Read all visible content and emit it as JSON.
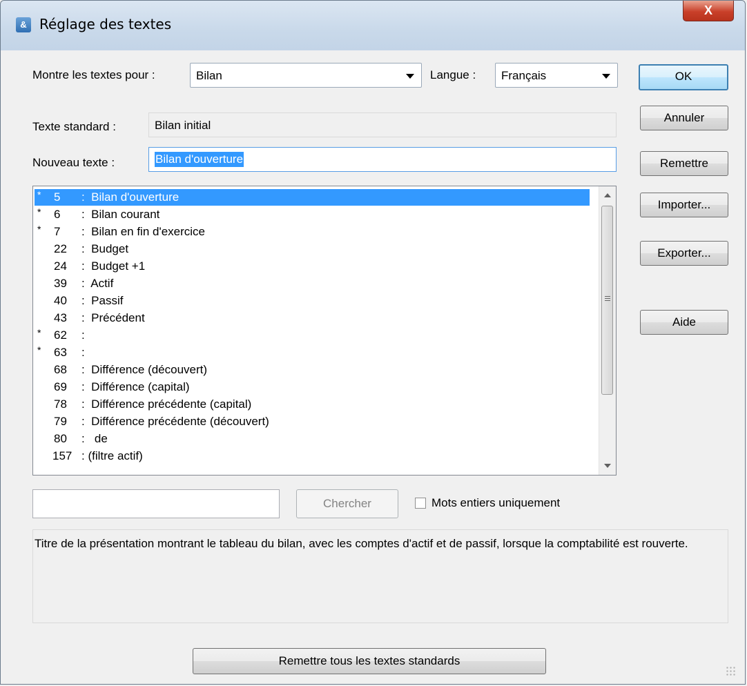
{
  "window": {
    "title": "Réglage des textes",
    "close_glyph": "X"
  },
  "filter": {
    "label": "Montre les textes pour :",
    "selected": "Bilan",
    "language_label": "Langue :",
    "language_selected": "Français"
  },
  "standard_text": {
    "label": "Texte standard :",
    "value": "Bilan initial"
  },
  "new_text": {
    "label": "Nouveau texte :",
    "value": "Bilan d'ouverture"
  },
  "buttons": {
    "ok": "OK",
    "cancel": "Annuler",
    "reset": "Remettre",
    "import": "Importer...",
    "export": "Exporter...",
    "help": "Aide",
    "search": "Chercher",
    "reset_all": "Remettre tous les textes standards"
  },
  "search": {
    "value": "",
    "whole_words_label": "Mots entiers uniquement",
    "whole_words_checked": false
  },
  "list": {
    "items": [
      {
        "star": "*",
        "num": "5",
        "text": ":  Bilan d'ouverture",
        "selected": true
      },
      {
        "star": "*",
        "num": "6",
        "text": ":  Bilan courant",
        "selected": false
      },
      {
        "star": "*",
        "num": "7",
        "text": ":  Bilan en fin d'exercice",
        "selected": false
      },
      {
        "star": "",
        "num": "22",
        "text": ":  Budget",
        "selected": false
      },
      {
        "star": "",
        "num": "24",
        "text": ":  Budget +1",
        "selected": false
      },
      {
        "star": "",
        "num": "39",
        "text": ":  Actif",
        "selected": false
      },
      {
        "star": "",
        "num": "40",
        "text": ":  Passif",
        "selected": false
      },
      {
        "star": "",
        "num": "43",
        "text": ":  Précédent",
        "selected": false
      },
      {
        "star": "*",
        "num": "62",
        "text": ":",
        "selected": false
      },
      {
        "star": "*",
        "num": "63",
        "text": ":",
        "selected": false
      },
      {
        "star": "",
        "num": "68",
        "text": ":  Différence (découvert)",
        "selected": false
      },
      {
        "star": "",
        "num": "69",
        "text": ":  Différence (capital)",
        "selected": false
      },
      {
        "star": "",
        "num": "78",
        "text": ":  Différence précédente (capital)",
        "selected": false
      },
      {
        "star": "",
        "num": "79",
        "text": ":  Différence précédente (découvert)",
        "selected": false
      },
      {
        "star": "",
        "num": "80",
        "text": ":   de",
        "selected": false
      },
      {
        "star": "",
        "num": "157",
        "text": ": (filtre actif)",
        "selected": false
      }
    ]
  },
  "description": "Titre de la présentation montrant le tableau du bilan, avec les comptes d'actif et de passif, lorsque la comptabilité est rouverte.",
  "colors": {
    "selection": "#3399ff",
    "default_button_border": "#3c7fb1"
  }
}
